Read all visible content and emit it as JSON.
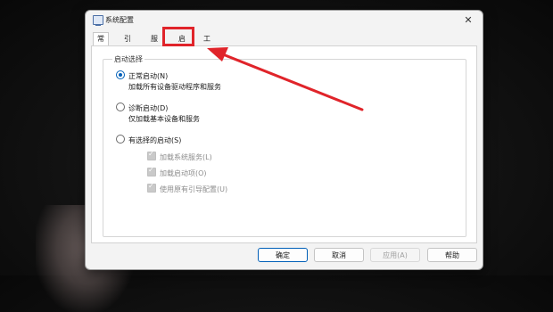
{
  "window": {
    "title": "系统配置",
    "icon": "system-config-icon",
    "close_glyph": "✕"
  },
  "tabs": [
    {
      "label": "常规",
      "active": true
    },
    {
      "label": "引导",
      "active": false
    },
    {
      "label": "服务",
      "active": false
    },
    {
      "label": "启动",
      "active": false,
      "highlighted": true
    },
    {
      "label": "工具",
      "active": false
    }
  ],
  "startup_selection": {
    "legend": "启动选择",
    "options": [
      {
        "label": "正常启动(N)",
        "description": "加载所有设备驱动程序和服务",
        "selected": true
      },
      {
        "label": "诊断启动(D)",
        "description": "仅加载基本设备和服务",
        "selected": false
      },
      {
        "label": "有选择的启动(S)",
        "description": "",
        "selected": false
      }
    ],
    "selective_items": [
      {
        "label": "加载系统服务(L)",
        "checked": true,
        "disabled": true
      },
      {
        "label": "加载启动项(O)",
        "checked": true,
        "disabled": true
      },
      {
        "label": "使用原有引导配置(U)",
        "checked": true,
        "disabled": true
      }
    ]
  },
  "buttons": {
    "ok": "确定",
    "cancel": "取消",
    "apply": "应用(A)",
    "help": "帮助"
  },
  "annotation": {
    "color": "#e0242a",
    "arrow_icon": "red-arrow-icon"
  }
}
